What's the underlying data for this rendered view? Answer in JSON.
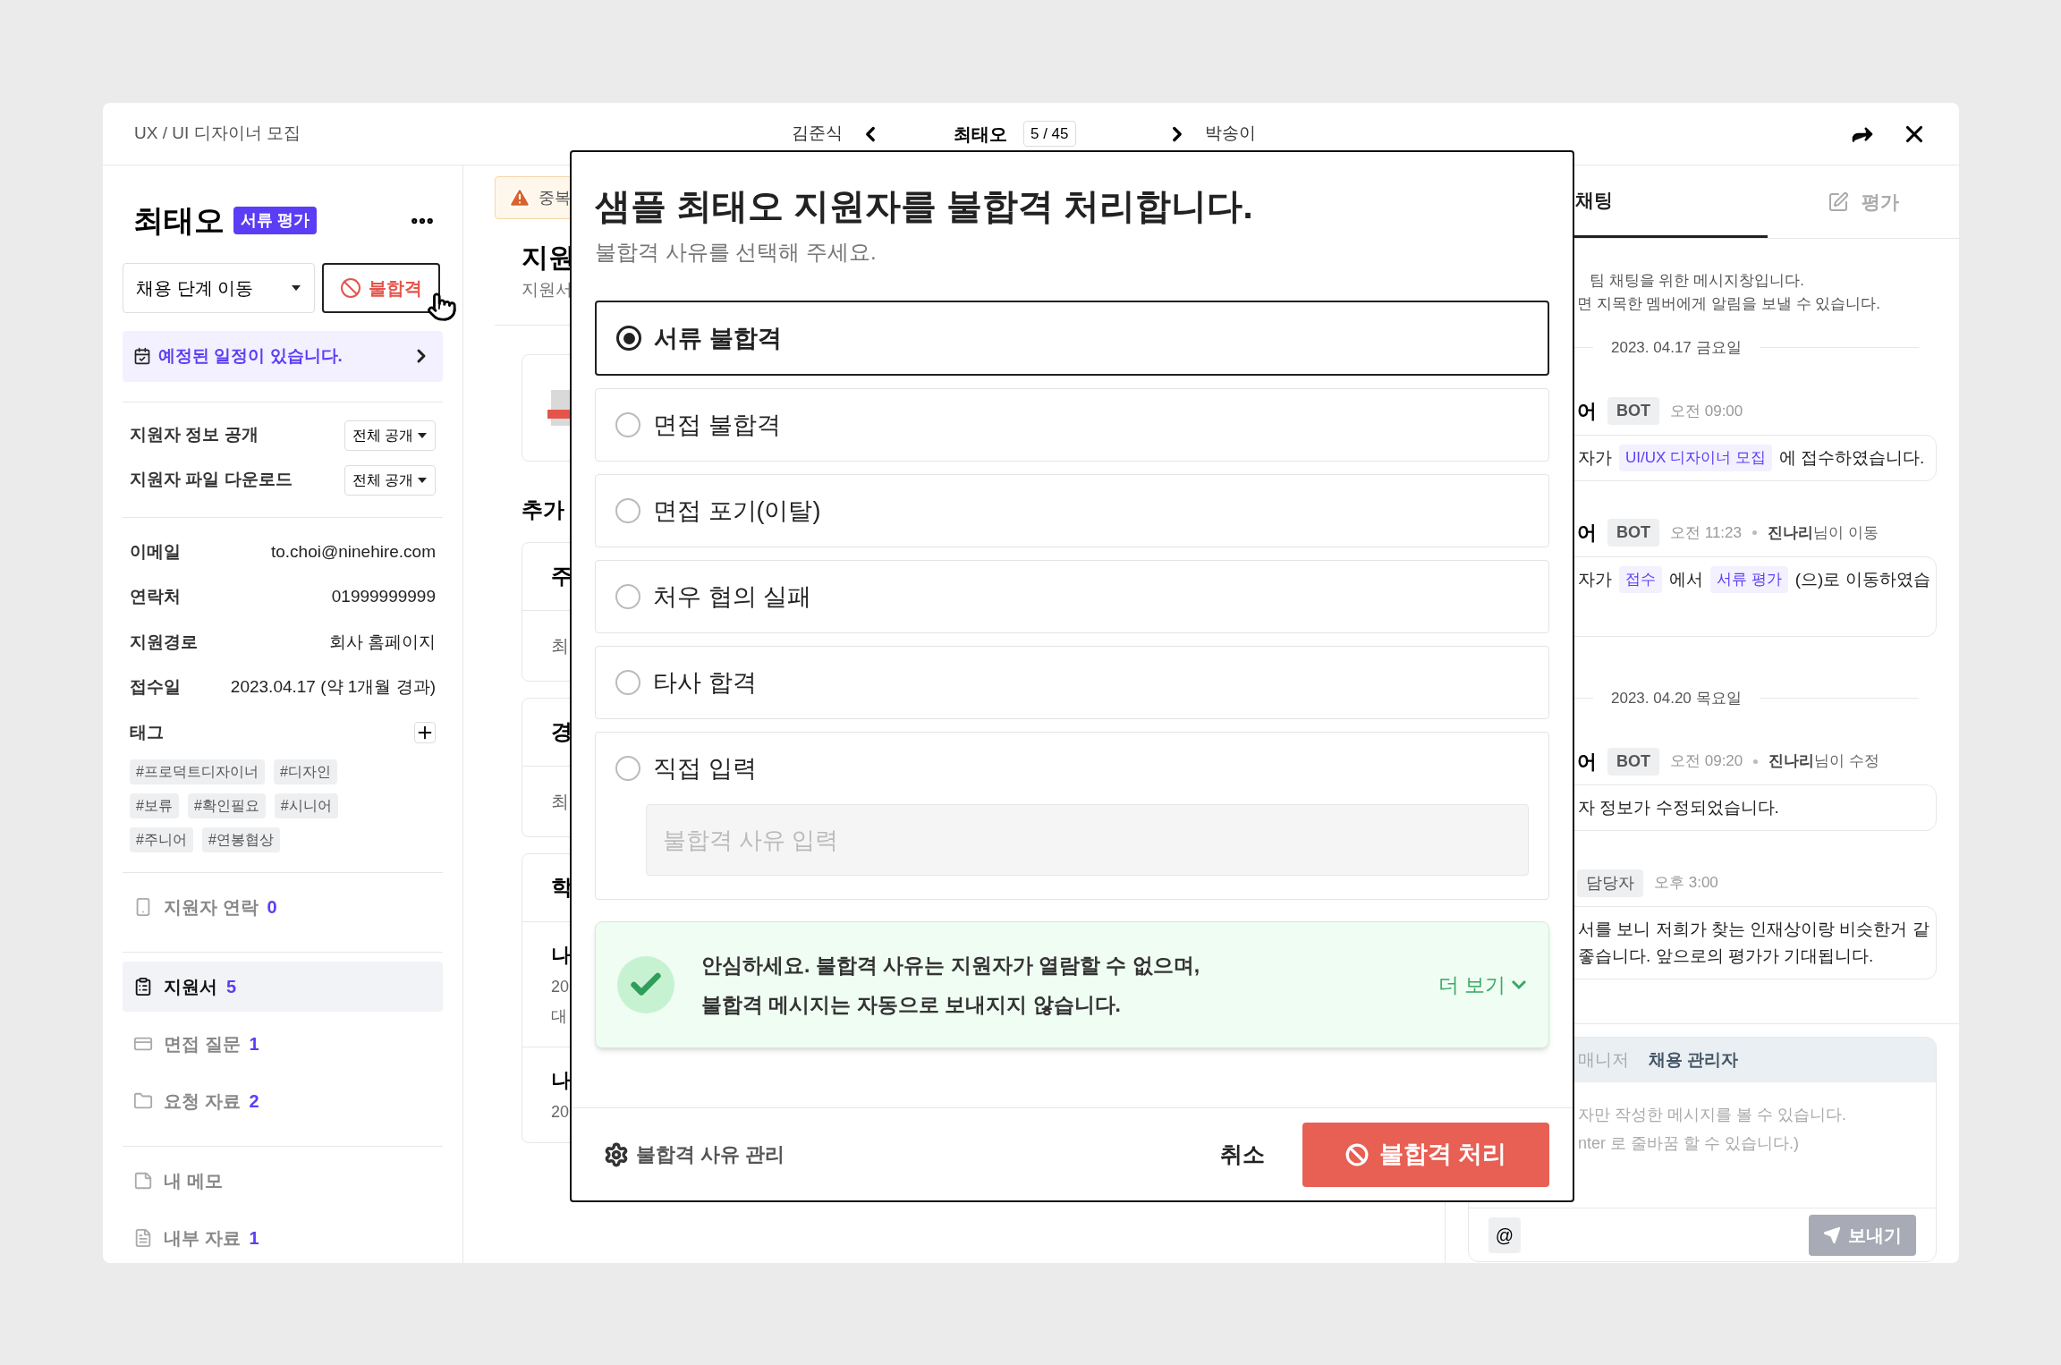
{
  "header": {
    "breadcrumb": "UX / UI 디자이너 모집",
    "prev_name": "김준식",
    "current_name": "최태오",
    "position": "5 / 45",
    "next_name": "박송이"
  },
  "candidate": {
    "name": "최태오",
    "stage_badge": "서류 평가",
    "stage_select": "채용 단계 이동",
    "reject_button": "불합격",
    "schedule_notice": "예정된 일정이 있습니다."
  },
  "settings": [
    {
      "label": "지원자 정보 공개",
      "value": "전체 공개"
    },
    {
      "label": "지원자 파일 다운로드",
      "value": "전체 공개"
    }
  ],
  "info": [
    {
      "label": "이메일",
      "value": "to.choi@ninehire.com"
    },
    {
      "label": "연락처",
      "value": "01999999999"
    },
    {
      "label": "지원경로",
      "value": "회사 홈페이지"
    },
    {
      "label": "접수일",
      "value": "2023.04.17 (약 1개월 경과)"
    }
  ],
  "tags": {
    "label": "태그",
    "items": [
      "#프로덕트디자이너",
      "#디자인",
      "#보류",
      "#확인필요",
      "#시니어",
      "#주니어",
      "#연봉협상"
    ]
  },
  "nav_groups": [
    {
      "items": [
        {
          "label": "지원자 연락",
          "count": "0",
          "selected": false
        }
      ]
    },
    {
      "items": [
        {
          "label": "지원서",
          "count": "5",
          "selected": true
        },
        {
          "label": "면접 질문",
          "count": "1",
          "selected": false
        },
        {
          "label": "요청 자료",
          "count": "2",
          "selected": false
        }
      ]
    },
    {
      "items": [
        {
          "label": "내 메모",
          "selected": false
        },
        {
          "label": "내부 자료",
          "count": "1",
          "selected": false
        }
      ]
    }
  ],
  "background_page": {
    "warning": "중복",
    "title": "지원",
    "subtitle": "지원서",
    "section_title": "추가",
    "cards": [
      {
        "heading": "주",
        "lines": [
          "최"
        ]
      },
      {
        "heading": "경",
        "lines": [
          "최"
        ]
      },
      {
        "heading": "학",
        "entries": [
          {
            "title": "나",
            "lines": [
              "20",
              "대"
            ]
          },
          {
            "title": "나",
            "lines": [
              "20"
            ]
          }
        ]
      }
    ]
  },
  "modal": {
    "title": "샘플 최태오 지원자를 불합격 처리합니다.",
    "subtitle": "불합격 사유를 선택해 주세요.",
    "reasons": [
      {
        "label": "서류 불합격",
        "selected": true
      },
      {
        "label": "면접 불합격",
        "selected": false
      },
      {
        "label": "면접 포기(이탈)",
        "selected": false
      },
      {
        "label": "처우 협의 실패",
        "selected": false
      },
      {
        "label": "타사 합격",
        "selected": false
      },
      {
        "label": "직접 입력",
        "selected": false,
        "kind": "custom",
        "placeholder": "불합격 사유 입력"
      }
    ],
    "notice": {
      "text": "안심하세요. 불합격 사유는 지원자가 열람할 수 없으며,\n불합격 메시지는 자동으로 보내지지 않습니다.",
      "more": "더 보기"
    },
    "manage_link": "불합격 사유 관리",
    "cancel": "취소",
    "confirm": "불합격 처리"
  },
  "chat": {
    "tabs": [
      {
        "label": "채팅",
        "selected": true
      },
      {
        "label": "평가",
        "selected": false
      }
    ],
    "intro": [
      "팀 채팅을 위한 메시지창입니다.",
      "면 지목한 멤버에게 알림을 보낼 수 있습니다."
    ],
    "feed": [
      {
        "kind": "date",
        "text": "2023. 04.17 금요일"
      },
      {
        "kind": "message",
        "sender": "어",
        "badge": "BOT",
        "time": "오전 09:00",
        "body": [
          {
            "kind": "text",
            "text": "자가"
          },
          {
            "kind": "tag",
            "text": "UI/UX 디자이너 모집"
          },
          {
            "kind": "text",
            "text": "에 접수하였습니다."
          }
        ]
      },
      {
        "kind": "message",
        "sender": "어",
        "badge": "BOT",
        "time": "오전 11:23",
        "actor": "진나리",
        "action": "님이 이동",
        "body": [
          {
            "kind": "text",
            "text": "자가"
          },
          {
            "kind": "tag",
            "text": "접수"
          },
          {
            "kind": "text",
            "text": "에서"
          },
          {
            "kind": "tag",
            "text": "서류 평가"
          },
          {
            "kind": "text",
            "text": "(으)로 이동하였습"
          }
        ]
      },
      {
        "kind": "date",
        "text": "2023. 04.20 목요일"
      },
      {
        "kind": "message",
        "sender": "어",
        "badge": "BOT",
        "time": "오전 09:20",
        "actor": "진나리",
        "action": "님이 수정",
        "body": [
          {
            "kind": "text",
            "text": "자 정보가 수정되었습니다."
          }
        ]
      },
      {
        "kind": "message",
        "badge": "담당자",
        "time": "오후 3:00",
        "body": [
          {
            "kind": "text",
            "text": "서를 보니 저희가 찾는 인재상이랑 비슷한거 같\n좋습니다. 앞으로의 평가가 기대됩니다."
          }
        ]
      }
    ],
    "composer": {
      "tabs": [
        {
          "label": "매니저",
          "selected": false
        },
        {
          "label": "채용 관리자",
          "selected": true
        }
      ],
      "placeholder": "자만 작성한 메시지를 볼 수 있습니다.\nnter 로 줄바꿈 할 수 있습니다.)",
      "mention": "@",
      "send": {
        "label": "보내기",
        "disabled": true
      }
    }
  }
}
